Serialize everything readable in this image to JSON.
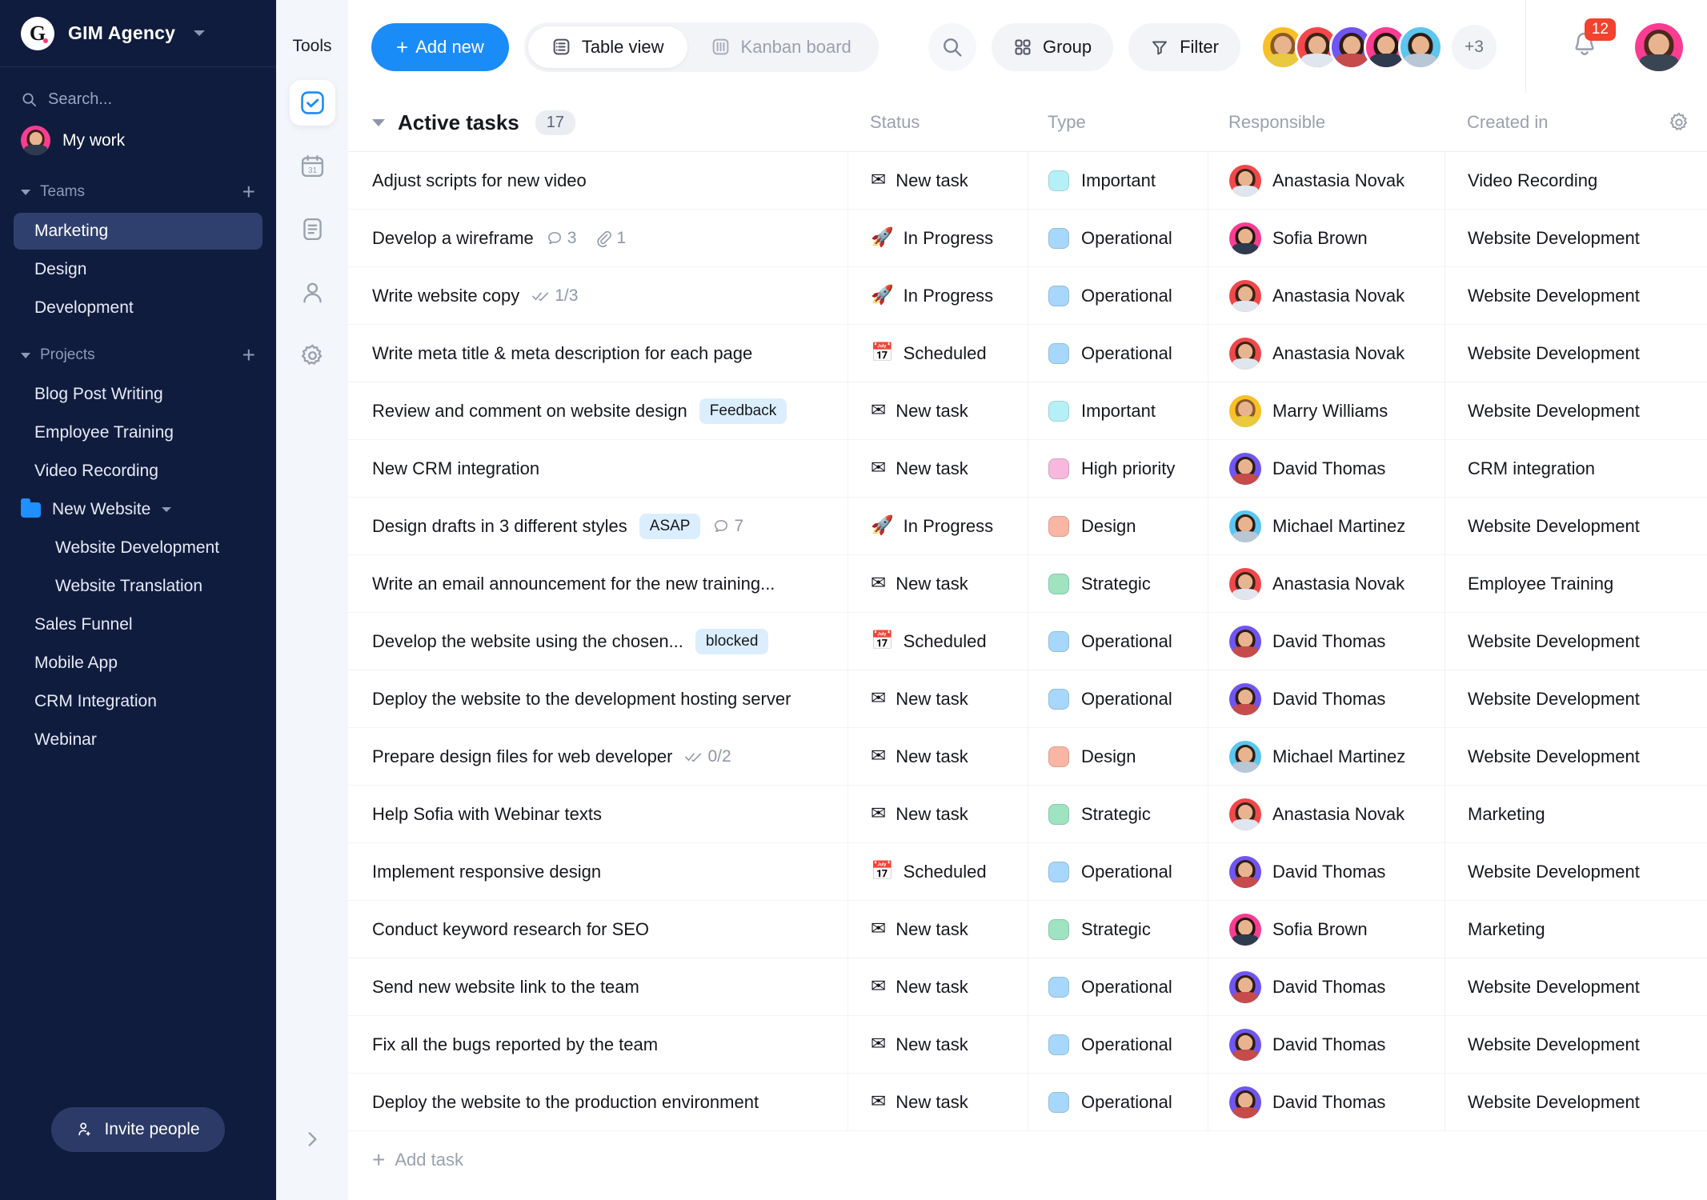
{
  "sidebar": {
    "org_name": "GIM Agency",
    "logo_letter": "G",
    "search_placeholder": "Search...",
    "my_work_label": "My work",
    "teams_section": {
      "label": "Teams",
      "add_label": "+"
    },
    "teams": [
      {
        "label": "Marketing",
        "active": true
      },
      {
        "label": "Design",
        "active": false
      },
      {
        "label": "Development",
        "active": false
      }
    ],
    "projects_section": {
      "label": "Projects",
      "add_label": "+"
    },
    "projects": [
      {
        "label": "Blog Post Writing",
        "type": "item"
      },
      {
        "label": "Employee Training",
        "type": "item"
      },
      {
        "label": "Video Recording",
        "type": "item"
      },
      {
        "label": "New Website",
        "type": "folder"
      },
      {
        "label": "Website Development",
        "type": "sub"
      },
      {
        "label": "Website Translation",
        "type": "sub"
      },
      {
        "label": "Sales Funnel",
        "type": "item"
      },
      {
        "label": "Mobile App",
        "type": "item"
      },
      {
        "label": "CRM Integration",
        "type": "item"
      },
      {
        "label": "Webinar",
        "type": "item"
      }
    ],
    "invite_label": "Invite people",
    "accent_folder_color": "#1e90ff",
    "active_item_color": "#30406e",
    "background_color": "#101c3e"
  },
  "rail": {
    "title": "Tools",
    "items": [
      {
        "icon": "tasks-check-icon",
        "active": true
      },
      {
        "icon": "calendar-icon",
        "active": false
      },
      {
        "icon": "document-icon",
        "active": false
      },
      {
        "icon": "person-icon",
        "active": false
      },
      {
        "icon": "gear-icon",
        "active": false
      }
    ],
    "expand_icon": "chevron-right-icon"
  },
  "toolbar": {
    "add_new_label": "Add new",
    "views": [
      {
        "label": "Table view",
        "icon": "table-icon",
        "active": true
      },
      {
        "label": "Kanban board",
        "icon": "kanban-icon",
        "active": false
      }
    ],
    "search_icon": "search-icon",
    "group_label": "Group",
    "filter_label": "Filter",
    "avatar_overflow": "+3",
    "notifications_count": "12",
    "accent_color": "#1a8cf8",
    "badge_color": "#f4422e"
  },
  "table": {
    "group": {
      "title": "Active tasks",
      "count": "17"
    },
    "columns": [
      "Status",
      "Type",
      "Responsible",
      "Created in"
    ],
    "settings_icon": "gear-icon",
    "add_task_label": "Add task",
    "type_colors": {
      "Important": "#b6f0f7",
      "Operational": "#a7d8fb",
      "High priority": "#f6b8dd",
      "Design": "#fab6a5",
      "Strategic": "#9fe3c1"
    },
    "status_emoji": {
      "New task": "✉",
      "In Progress": "🚀",
      "Scheduled": "📅"
    },
    "avatar_colors": {
      "Anastasia Novak": "#f2474b",
      "Sofia Brown": "#fb3d92",
      "Marry Williams": "#f9bf26",
      "David Thomas": "#7055f2",
      "Michael Martinez": "#5bc6f0"
    },
    "rows": [
      {
        "task": "Adjust scripts for new video",
        "tag": "",
        "comments": "",
        "attachments": "",
        "checklist": "",
        "status": "New task",
        "type": "Important",
        "responsible": "Anastasia Novak",
        "created": "Video Recording"
      },
      {
        "task": "Develop a wireframe",
        "tag": "",
        "comments": "3",
        "attachments": "1",
        "checklist": "",
        "status": "In Progress",
        "type": "Operational",
        "responsible": "Sofia Brown",
        "created": "Website Development"
      },
      {
        "task": "Write website copy",
        "tag": "",
        "comments": "",
        "attachments": "",
        "checklist": "1/3",
        "status": "In Progress",
        "type": "Operational",
        "responsible": "Anastasia Novak",
        "created": "Website Development"
      },
      {
        "task": "Write meta title & meta description for each page",
        "tag": "",
        "comments": "",
        "attachments": "",
        "checklist": "",
        "status": "Scheduled",
        "type": "Operational",
        "responsible": "Anastasia Novak",
        "created": "Website Development"
      },
      {
        "task": "Review and comment on website design",
        "tag": "Feedback",
        "comments": "",
        "attachments": "",
        "checklist": "",
        "status": "New task",
        "type": "Important",
        "responsible": "Marry Williams",
        "created": "Website Development"
      },
      {
        "task": "New CRM integration",
        "tag": "",
        "comments": "",
        "attachments": "",
        "checklist": "",
        "status": "New task",
        "type": "High priority",
        "responsible": "David Thomas",
        "created": "CRM integration"
      },
      {
        "task": "Design drafts in 3 different styles",
        "tag": "ASAP",
        "comments": "7",
        "attachments": "",
        "checklist": "",
        "status": "In Progress",
        "type": "Design",
        "responsible": "Michael Martinez",
        "created": "Website Development"
      },
      {
        "task": "Write an email announcement for the new training...",
        "tag": "",
        "comments": "",
        "attachments": "",
        "checklist": "",
        "status": "New task",
        "type": "Strategic",
        "responsible": "Anastasia Novak",
        "created": "Employee Training"
      },
      {
        "task": "Develop the website using the chosen...",
        "tag": "blocked",
        "comments": "",
        "attachments": "",
        "checklist": "",
        "status": "Scheduled",
        "type": "Operational",
        "responsible": "David Thomas",
        "created": "Website Development"
      },
      {
        "task": "Deploy the website to the development hosting server",
        "tag": "",
        "comments": "",
        "attachments": "",
        "checklist": "",
        "status": "New task",
        "type": "Operational",
        "responsible": "David Thomas",
        "created": "Website Development"
      },
      {
        "task": "Prepare design files for web developer",
        "tag": "",
        "comments": "",
        "attachments": "",
        "checklist": "0/2",
        "status": "New task",
        "type": "Design",
        "responsible": "Michael Martinez",
        "created": "Website Development"
      },
      {
        "task": "Help Sofia with Webinar texts",
        "tag": "",
        "comments": "",
        "attachments": "",
        "checklist": "",
        "status": "New task",
        "type": "Strategic",
        "responsible": "Anastasia Novak",
        "created": "Marketing"
      },
      {
        "task": "Implement responsive design",
        "tag": "",
        "comments": "",
        "attachments": "",
        "checklist": "",
        "status": "Scheduled",
        "type": "Operational",
        "responsible": "David Thomas",
        "created": "Website Development"
      },
      {
        "task": "Conduct keyword research for SEO",
        "tag": "",
        "comments": "",
        "attachments": "",
        "checklist": "",
        "status": "New task",
        "type": "Strategic",
        "responsible": "Sofia Brown",
        "created": "Marketing"
      },
      {
        "task": "Send new website link to the team",
        "tag": "",
        "comments": "",
        "attachments": "",
        "checklist": "",
        "status": "New task",
        "type": "Operational",
        "responsible": "David Thomas",
        "created": "Website Development"
      },
      {
        "task": "Fix all the bugs reported by the team",
        "tag": "",
        "comments": "",
        "attachments": "",
        "checklist": "",
        "status": "New task",
        "type": "Operational",
        "responsible": "David Thomas",
        "created": "Website Development"
      },
      {
        "task": "Deploy the website to the production environment",
        "tag": "",
        "comments": "",
        "attachments": "",
        "checklist": "",
        "status": "New task",
        "type": "Operational",
        "responsible": "David Thomas",
        "created": "Website Development"
      }
    ]
  }
}
